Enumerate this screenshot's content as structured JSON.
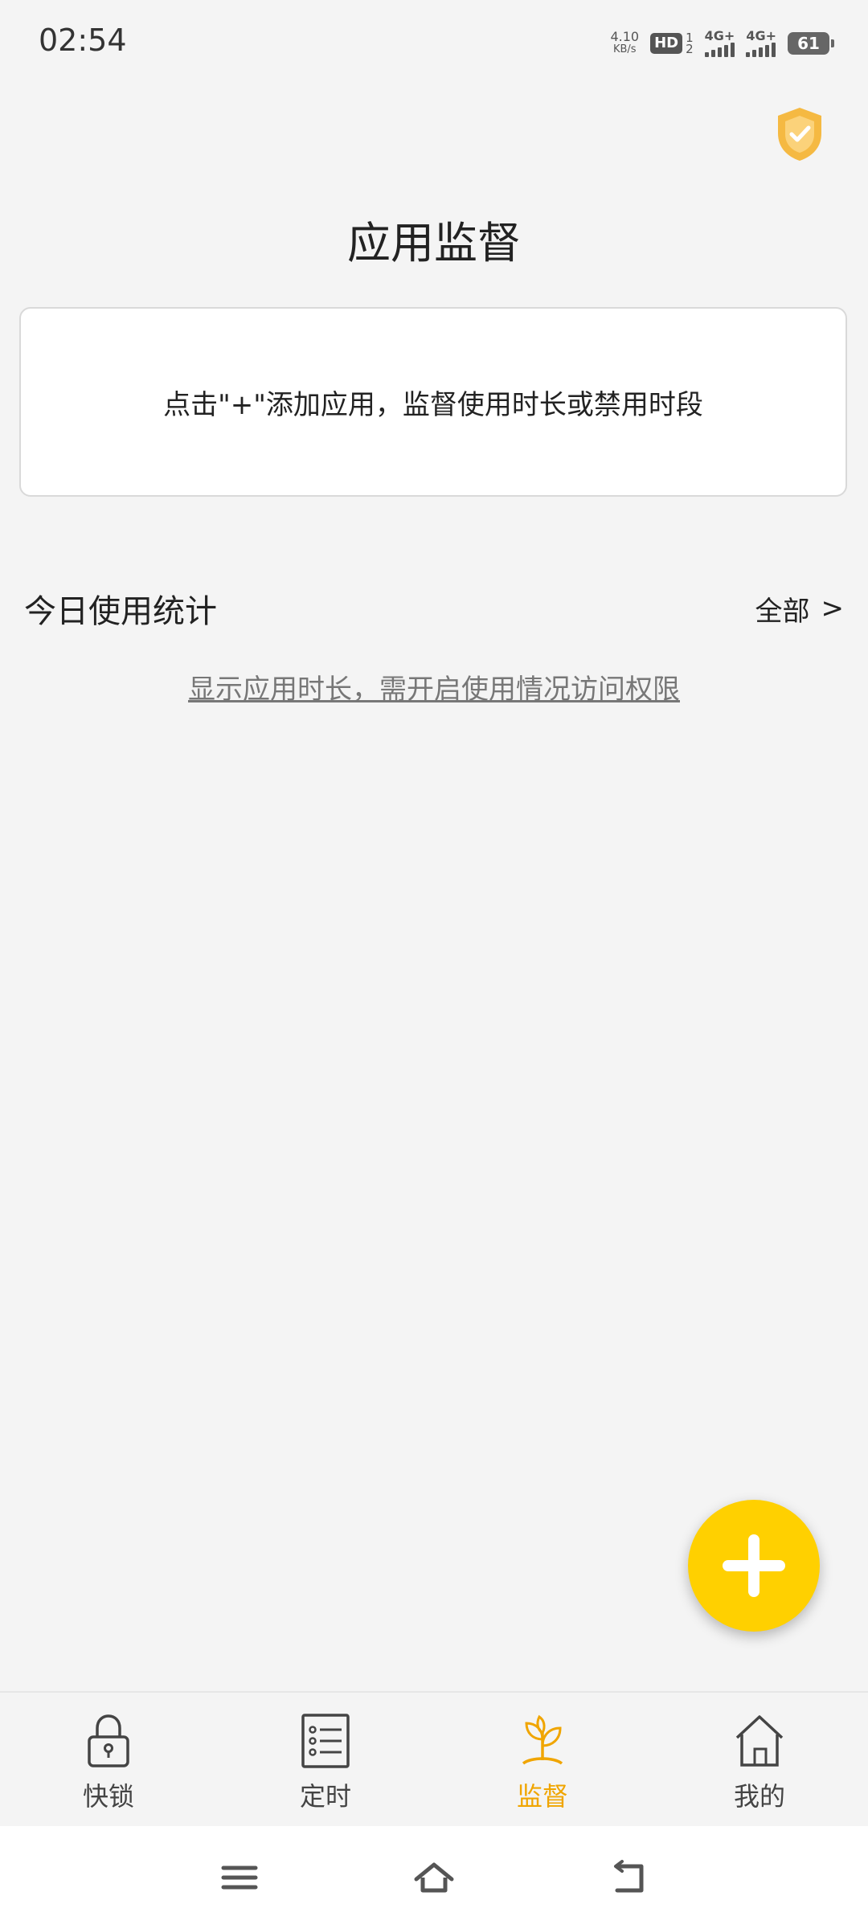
{
  "status_bar": {
    "time": "02:54",
    "speed_value": "4.10",
    "speed_unit": "KB/s",
    "hd_label": "HD",
    "hd_sim_1": "1",
    "hd_sim_2": "2",
    "network_1": "4G+",
    "network_2": "4G+",
    "battery_level": "61"
  },
  "header": {
    "title": "应用监督"
  },
  "hint_card": {
    "text": "点击\"+\"添加应用，监督使用时长或禁用时段"
  },
  "usage_stats": {
    "title": "今日使用统计",
    "all_label": "全部",
    "all_arrow": ">",
    "permission_link": "显示应用时长，需开启使用情况访问权限"
  },
  "fab": {
    "icon": "plus-icon"
  },
  "tabs": [
    {
      "label": "快锁",
      "icon": "lock-icon",
      "active": false
    },
    {
      "label": "定时",
      "icon": "list-icon",
      "active": false
    },
    {
      "label": "监督",
      "icon": "sprout-icon",
      "active": true
    },
    {
      "label": "我的",
      "icon": "home-icon",
      "active": false
    }
  ],
  "colors": {
    "accent": "#f0a500",
    "fab": "#ffd000",
    "background": "#f4f4f4",
    "shield": "#f5b942"
  }
}
